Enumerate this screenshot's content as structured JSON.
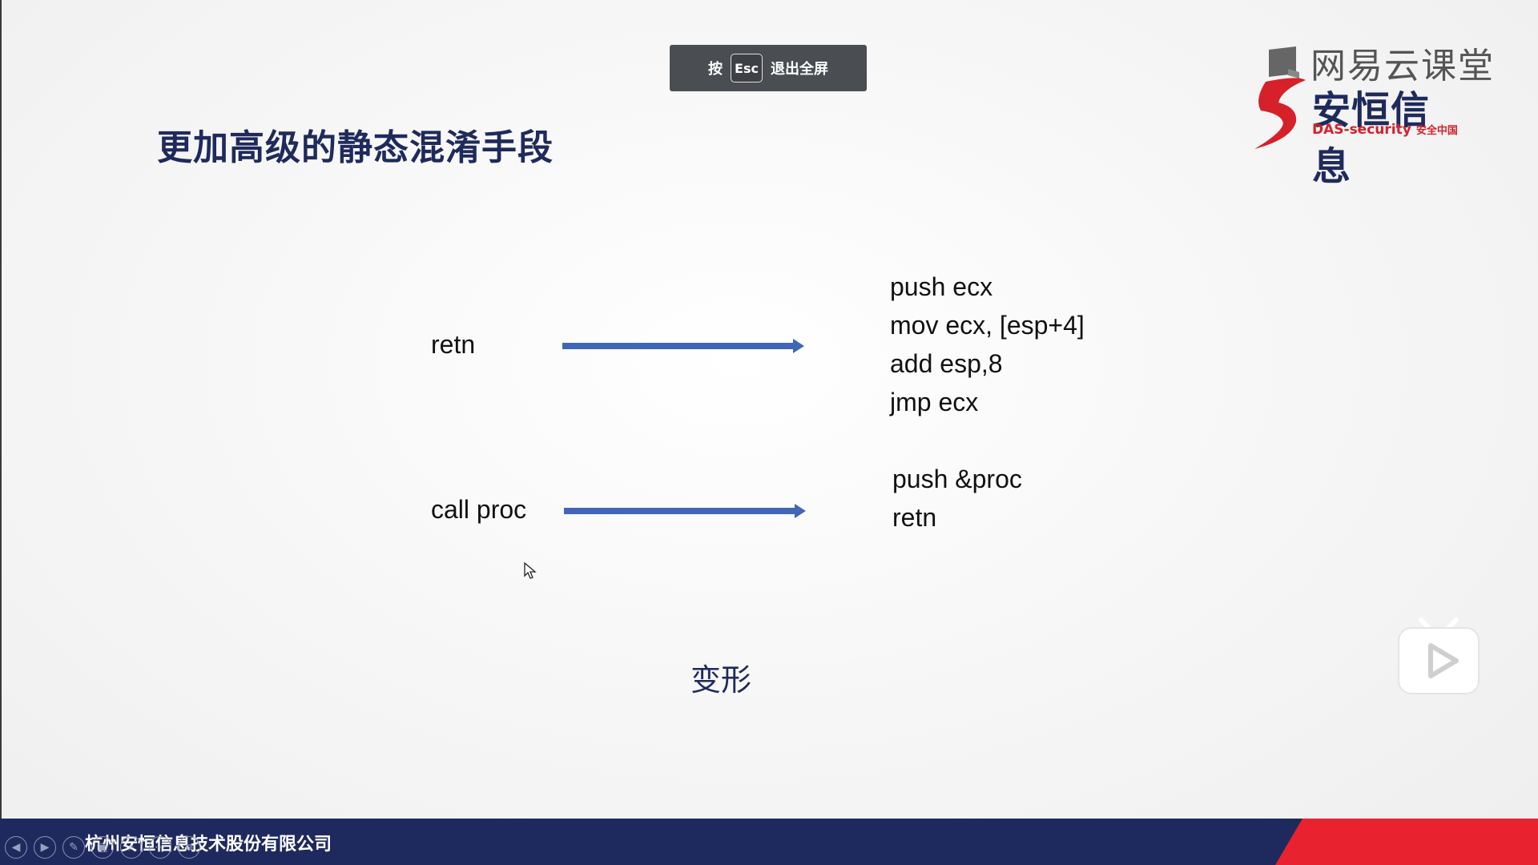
{
  "esc_hint": {
    "prefix": "按",
    "key": "Esc",
    "suffix": "退出全屏"
  },
  "slide": {
    "title": "更加高级的静态混淆手段",
    "row1": {
      "left": "retn",
      "right": [
        "push ecx",
        "mov ecx, [esp+4]",
        "add esp,8",
        "jmp ecx"
      ]
    },
    "row2": {
      "left": "call proc",
      "right": [
        "push &proc",
        "retn"
      ]
    },
    "caption": "变形"
  },
  "logos": {
    "netease": "网易云课堂",
    "anheng_cn": "安恒信息",
    "anheng_en": "DAS-security",
    "anheng_tag": "安全中国"
  },
  "footer": {
    "company": "杭州安恒信息技术股份有限公司"
  },
  "colors": {
    "title": "#1f2a5c",
    "arrow": "#3f67b5",
    "footer": "#1e2a5e",
    "footer_accent": "#e8222e"
  },
  "icons": [
    "prev-slide-icon",
    "next-slide-icon",
    "pen-icon",
    "slides-icon",
    "zoom-icon",
    "more-icon",
    "menu-icon"
  ]
}
